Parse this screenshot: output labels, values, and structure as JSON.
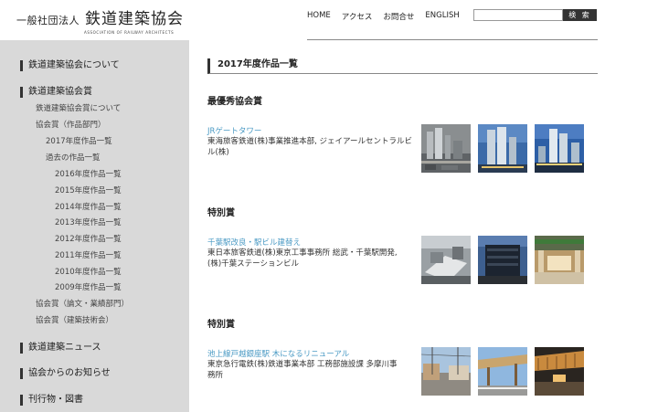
{
  "header": {
    "logo_small": "一般社団法人",
    "logo_big": "鉄道建築協会",
    "logo_sub": "ASSOCIATION OF RAILWAY ARCHITECTS",
    "nav": [
      "HOME",
      "アクセス",
      "お問合せ",
      "ENGLISH"
    ],
    "search_placeholder": "",
    "search_button": "検 索"
  },
  "sidebar": {
    "about": "鉄道建築協会について",
    "award": "鉄道建築協会賞",
    "award_about": "鉄道建築協会賞について",
    "award_works": "協会賞（作品部門）",
    "year_2017": "2017年度作品一覧",
    "past_works": "過去の作品一覧",
    "years": [
      "2016年度作品一覧",
      "2015年度作品一覧",
      "2014年度作品一覧",
      "2013年度作品一覧",
      "2012年度作品一覧",
      "2011年度作品一覧",
      "2010年度作品一覧",
      "2009年度作品一覧"
    ],
    "award_papers": "協会賞（論文・業績部門）",
    "award_tech": "協会賞（建築技術会）",
    "news": "鉄道建築ニュース",
    "notices": "協会からのお知らせ",
    "publications": "刊行物・図書"
  },
  "main": {
    "title": "2017年度作品一覧",
    "awards": [
      {
        "award": "最優秀協会賞",
        "work_title": "JRゲートタワー",
        "desc_lines": [
          "東海旅客鉄道(株)事業推進本部, ジェイアールセントラルビ",
          "ル(株)"
        ]
      },
      {
        "award": "特別賞",
        "work_title": "千葉駅改良・駅ビル建替え",
        "desc_lines": [
          "東日本旅客鉄道(株)東京工事事務所 総武・千葉駅開発,",
          "(株)千葉ステーションビル"
        ]
      },
      {
        "award": "特別賞",
        "work_title": "池上線戸越銀座駅 木になるリニューアル",
        "desc_lines": [
          "東京急行電鉄(株)鉄道事業本部 工務部施設課 多摩川事",
          "務所"
        ]
      }
    ]
  },
  "colors": {
    "sidebar_bg": "#d9d9d9",
    "link": "#4a9ac4",
    "search_button_bg": "#333333"
  }
}
